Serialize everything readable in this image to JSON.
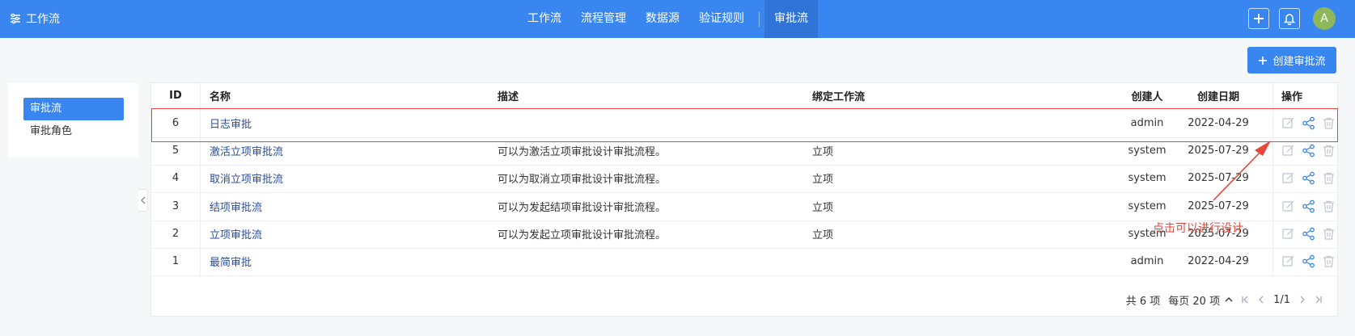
{
  "topbar": {
    "brand": "工作流",
    "nav": [
      "工作流",
      "流程管理",
      "数据源",
      "验证规则",
      "审批流"
    ],
    "active_nav": "审批流",
    "avatar_letter": "A"
  },
  "create_button": "创建审批流",
  "sidebar": {
    "items": [
      {
        "label": "审批流",
        "active": true
      },
      {
        "label": "审批角色",
        "active": false
      }
    ]
  },
  "table": {
    "columns": {
      "id": "ID",
      "name": "名称",
      "desc": "描述",
      "workflow": "绑定工作流",
      "creator": "创建人",
      "date": "创建日期",
      "ops": "操作"
    },
    "rows": [
      {
        "id": "6",
        "name": "日志审批",
        "desc": "",
        "workflow": "",
        "creator": "admin",
        "date": "2022-04-29"
      },
      {
        "id": "5",
        "name": "激活立项审批流",
        "desc": "可以为激活立项审批设计审批流程。",
        "workflow": "立项",
        "creator": "system",
        "date": "2025-07-29"
      },
      {
        "id": "4",
        "name": "取消立项审批流",
        "desc": "可以为取消立项审批设计审批流程。",
        "workflow": "立项",
        "creator": "system",
        "date": "2025-07-29"
      },
      {
        "id": "3",
        "name": "结项审批流",
        "desc": "可以为发起结项审批设计审批流程。",
        "workflow": "立项",
        "creator": "system",
        "date": "2025-07-29"
      },
      {
        "id": "2",
        "name": "立项审批流",
        "desc": "可以为发起立项审批设计审批流程。",
        "workflow": "立项",
        "creator": "system",
        "date": "2025-07-29"
      },
      {
        "id": "1",
        "name": "最简审批",
        "desc": "",
        "workflow": "",
        "creator": "admin",
        "date": "2022-04-29"
      }
    ]
  },
  "pager": {
    "total": "共 6 项",
    "per_page": "每页 20 项",
    "page": "1/1"
  },
  "annotation": {
    "text": "点击可以进行设计",
    "color": "#e8453c"
  },
  "colors": {
    "primary": "#3a86f0",
    "link": "#2a4d9b",
    "icon_gray": "#bfc4cc",
    "icon_blue": "#3a86f0"
  }
}
